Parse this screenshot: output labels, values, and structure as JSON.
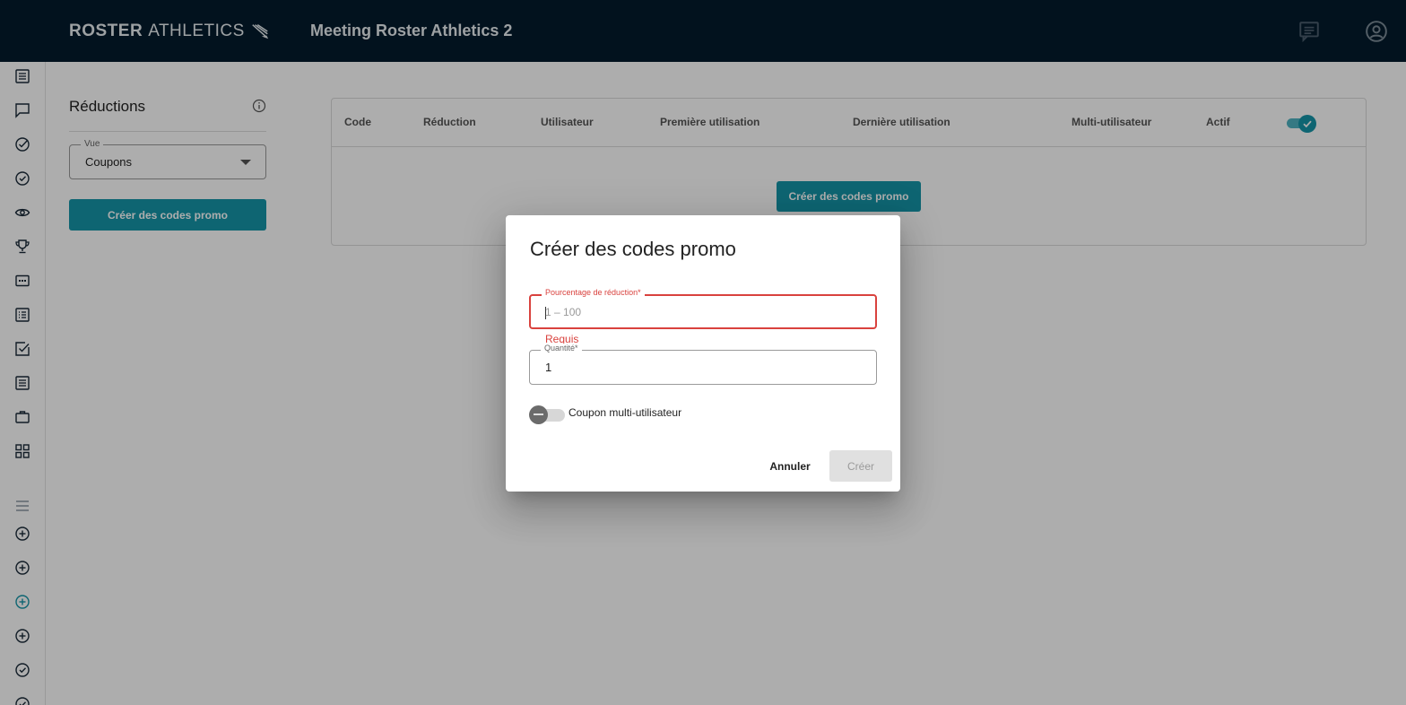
{
  "header": {
    "logo_bold": "ROSTER",
    "logo_thin": "ATHLETICS",
    "title": "Meeting Roster Athletics 2"
  },
  "panel": {
    "title": "Réductions",
    "view_label": "Vue",
    "view_value": "Coupons",
    "create_button": "Créer des codes promo"
  },
  "table": {
    "columns": [
      "Code",
      "Réduction",
      "Utilisateur",
      "Première utilisation",
      "Dernière utilisation",
      "Multi-utilisateur",
      "Actif"
    ],
    "active_toggle_on": true,
    "empty_create_button": "Créer des codes promo"
  },
  "dialog": {
    "title": "Créer des codes promo",
    "discount_label": "Pourcentage de réduction*",
    "discount_placeholder": "1 – 100",
    "discount_error": "Requis",
    "quantity_label": "Quantité*",
    "quantity_value": "1",
    "multi_user_label": "Coupon multi-utilisateur",
    "multi_user_on": false,
    "cancel_button": "Annuler",
    "create_button": "Créer"
  },
  "colors": {
    "topbar": "#031b2d",
    "accent": "#1595a8",
    "error": "#d9423e"
  },
  "icons": {
    "sidebar": [
      "document-icon",
      "chat-icon",
      "check-circle-icon",
      "check-circle-icon",
      "eye-icon",
      "trophy-icon",
      "bib-icon",
      "list-icon",
      "checkbox-icon",
      "list-icon",
      "briefcase-icon",
      "grid-icon",
      "menu-icon",
      "add-circle-icon",
      "add-circle-icon",
      "add-circle-icon",
      "add-circle-icon",
      "check-circle-icon",
      "check-circle-icon"
    ],
    "topbar": [
      "message-icon",
      "account-circle-icon"
    ]
  }
}
